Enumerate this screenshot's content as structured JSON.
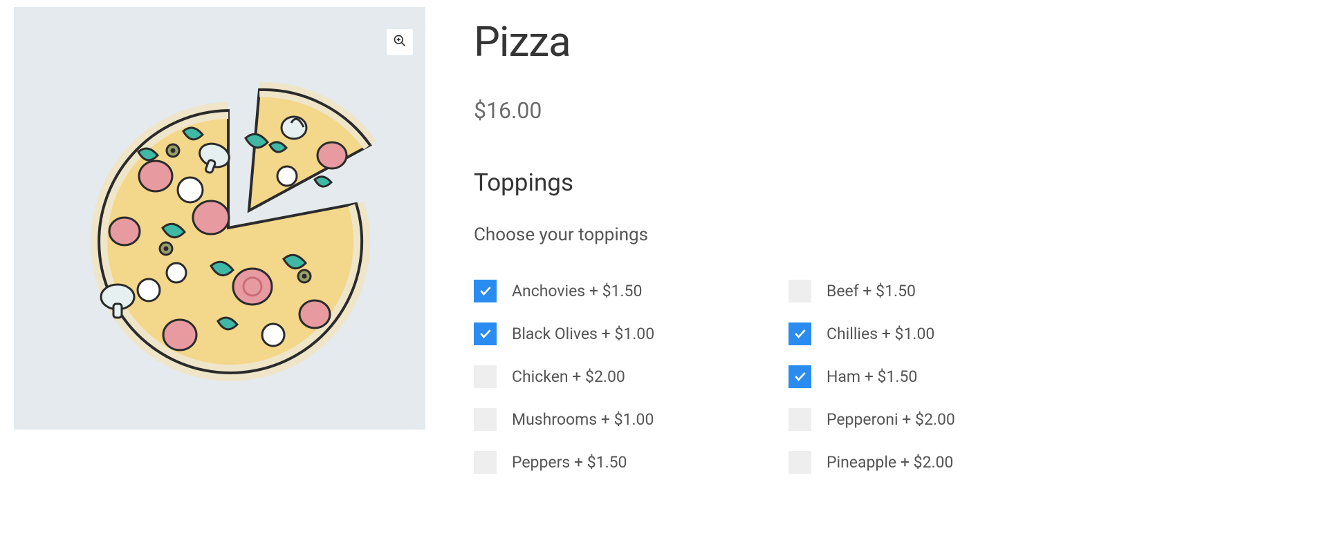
{
  "product": {
    "title": "Pizza",
    "price": "$16.00"
  },
  "toppings": {
    "section_title": "Toppings",
    "sub_title": "Choose your toppings",
    "items": [
      {
        "label": "Anchovies + $1.50",
        "checked": true
      },
      {
        "label": "Beef + $1.50",
        "checked": false
      },
      {
        "label": "Black Olives + $1.00",
        "checked": true
      },
      {
        "label": "Chillies + $1.00",
        "checked": true
      },
      {
        "label": "Chicken + $2.00",
        "checked": false
      },
      {
        "label": "Ham + $1.50",
        "checked": true
      },
      {
        "label": "Mushrooms + $1.00",
        "checked": false
      },
      {
        "label": "Pepperoni + $2.00",
        "checked": false
      },
      {
        "label": "Peppers + $1.50",
        "checked": false
      },
      {
        "label": "Pineapple + $2.00",
        "checked": false
      }
    ]
  },
  "colors": {
    "accent": "#2a8cf0",
    "panel_bg": "#e4eaee"
  }
}
